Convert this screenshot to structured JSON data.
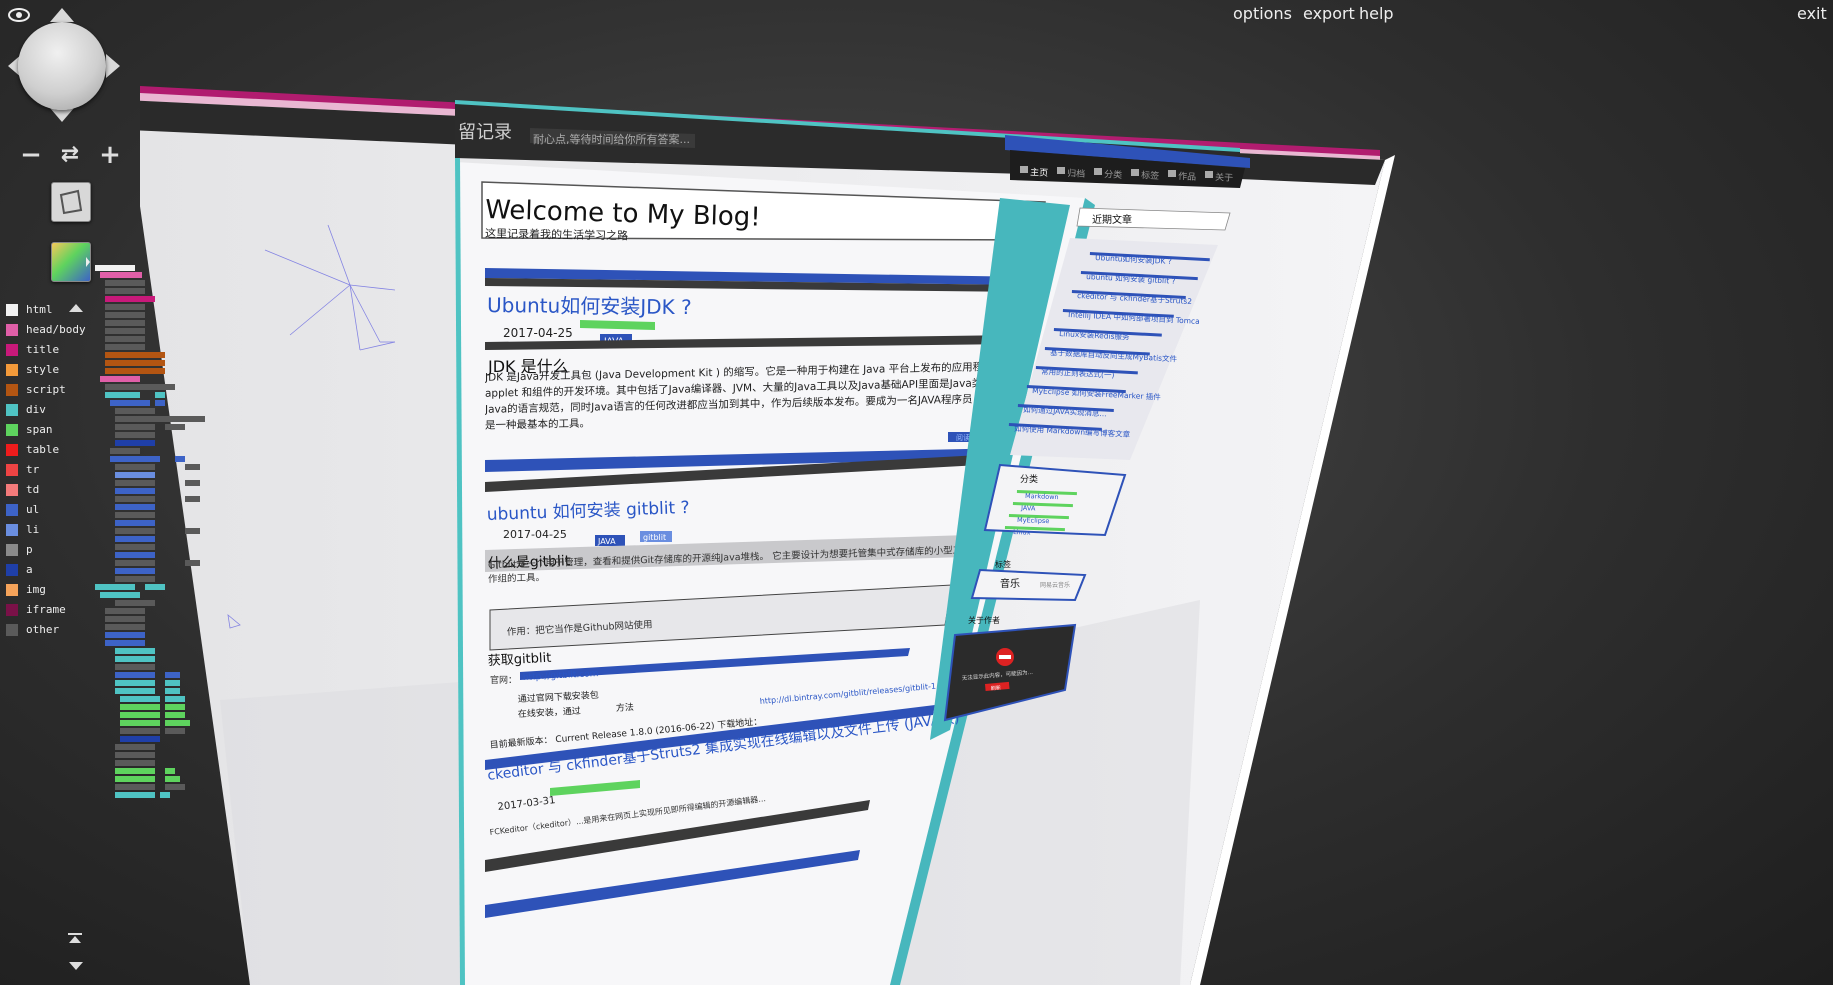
{
  "menu": {
    "options": "options",
    "export": "export",
    "help": "help",
    "exit": "exit"
  },
  "legend": [
    {
      "label": "html",
      "color": "#f2f2f2"
    },
    {
      "label": "head/body",
      "color": "#e05fa8"
    },
    {
      "label": "title",
      "color": "#c8197a"
    },
    {
      "label": "style",
      "color": "#f39a3a"
    },
    {
      "label": "script",
      "color": "#b35512"
    },
    {
      "label": "div",
      "color": "#4fc3c3"
    },
    {
      "label": "span",
      "color": "#5ed35e"
    },
    {
      "label": "table",
      "color": "#ee1c1c"
    },
    {
      "label": "tr",
      "color": "#ee4444"
    },
    {
      "label": "td",
      "color": "#f37a7a"
    },
    {
      "label": "ul",
      "color": "#3d63c7"
    },
    {
      "label": "li",
      "color": "#6a8ee0"
    },
    {
      "label": "p",
      "color": "#8a8a8a"
    },
    {
      "label": "a",
      "color": "#1f3fa8"
    },
    {
      "label": "img",
      "color": "#f5a35a"
    },
    {
      "label": "iframe",
      "color": "#7a1148"
    },
    {
      "label": "other",
      "color": "#5a5a5a"
    }
  ],
  "blog": {
    "header_title": "留记录",
    "header_tagline": "耐心点,等待时间给你所有答案...",
    "nav": [
      "主页",
      "归档",
      "分类",
      "标签",
      "作品",
      "关于"
    ],
    "welcome": "Welcome to My Blog!",
    "subtitle": "这里记录着我的生活学习之路",
    "posts": [
      {
        "title": "Ubuntu如何安装JDK ?",
        "date": "2017-04-25",
        "tag": "JAVA",
        "heading": "JDK 是什么",
        "body": "JDK 是Java开发工具包 (Java Development Kit ) 的缩写。它是一种用于构建在 Java 平台上发布的应用程序、applet 和组件的开发环境。其中包括了Java编译器、JVM、大量的Java工具以及Java基础API里面是Java类库和Java的语言规范，同时Java语言的任何改进都应当加到其中，作为后续版本发布。要成为一名JAVA程序员，JDK是一种最基本的工具。",
        "more": "阅读全文"
      },
      {
        "title": "ubuntu 如何安装 gitblit ?",
        "date": "2017-04-25",
        "tags": [
          "JAVA",
          "gitblit"
        ],
        "heading": "什么是gitblit",
        "body": "Gitblit是一个用于管理，查看和提供Git存储库的开源纯Java堆栈。 它主要设计为想要托管集中式存储库的小型工作组的工具。",
        "quote": "作用：把它当作是Github网站使用",
        "heading2": "获取gitblit",
        "site_label": "官网：",
        "site_link": "http://gitblit.com",
        "list1": "通过官网下载安装包",
        "list2": "在线安装，通过",
        "list2b": "方法",
        "release_label": "目前最新版本： Current Release 1.8.0 (2016-06-22) 下载地址：",
        "release_link": "http://dl.bintray.com/gitblit/releases/gitblit-1.8.0.tar.gz"
      },
      {
        "title": "ckeditor 与 ckfinder基于Struts2 集成实现在线编辑以及文件上传 (JAVA版)",
        "date": "2017-03-31",
        "body": "FCKeditor（ckeditor）...是用来在网页上实现所见即所得编辑的开源编辑器..."
      }
    ],
    "sidebar": {
      "recent_title": "近期文章",
      "recent": [
        "Ubuntu如何安装JDK ?",
        "ubuntu 如何安装 gitblit ?",
        "ckeditor 与 ckfinder基于Struts2 集成实现在线编辑以及文件上传(JAVA版)",
        "Intellij IDEA 中如何部署项目到 Tomcat ?",
        "Linux安装Redis服务",
        "基于数据库自动反向生成MyBatis文件",
        "常用的正则表达式(一)",
        "MyEclipse 如何安装FreeMarker 插件",
        "如何通过JAVA实现消息...",
        "如何使用 Markdown编写博客文章"
      ],
      "category_title": "分类",
      "categories": [
        "Markdown",
        "JAVA",
        "MyEclipse",
        "Linux"
      ],
      "tags_title": "标签",
      "music_title": "音乐",
      "music_note": "网易云音乐",
      "widget_title": "关于作者",
      "widget_msg": "无法显示此内容，可能因为...",
      "widget_btn": "刷新"
    }
  }
}
